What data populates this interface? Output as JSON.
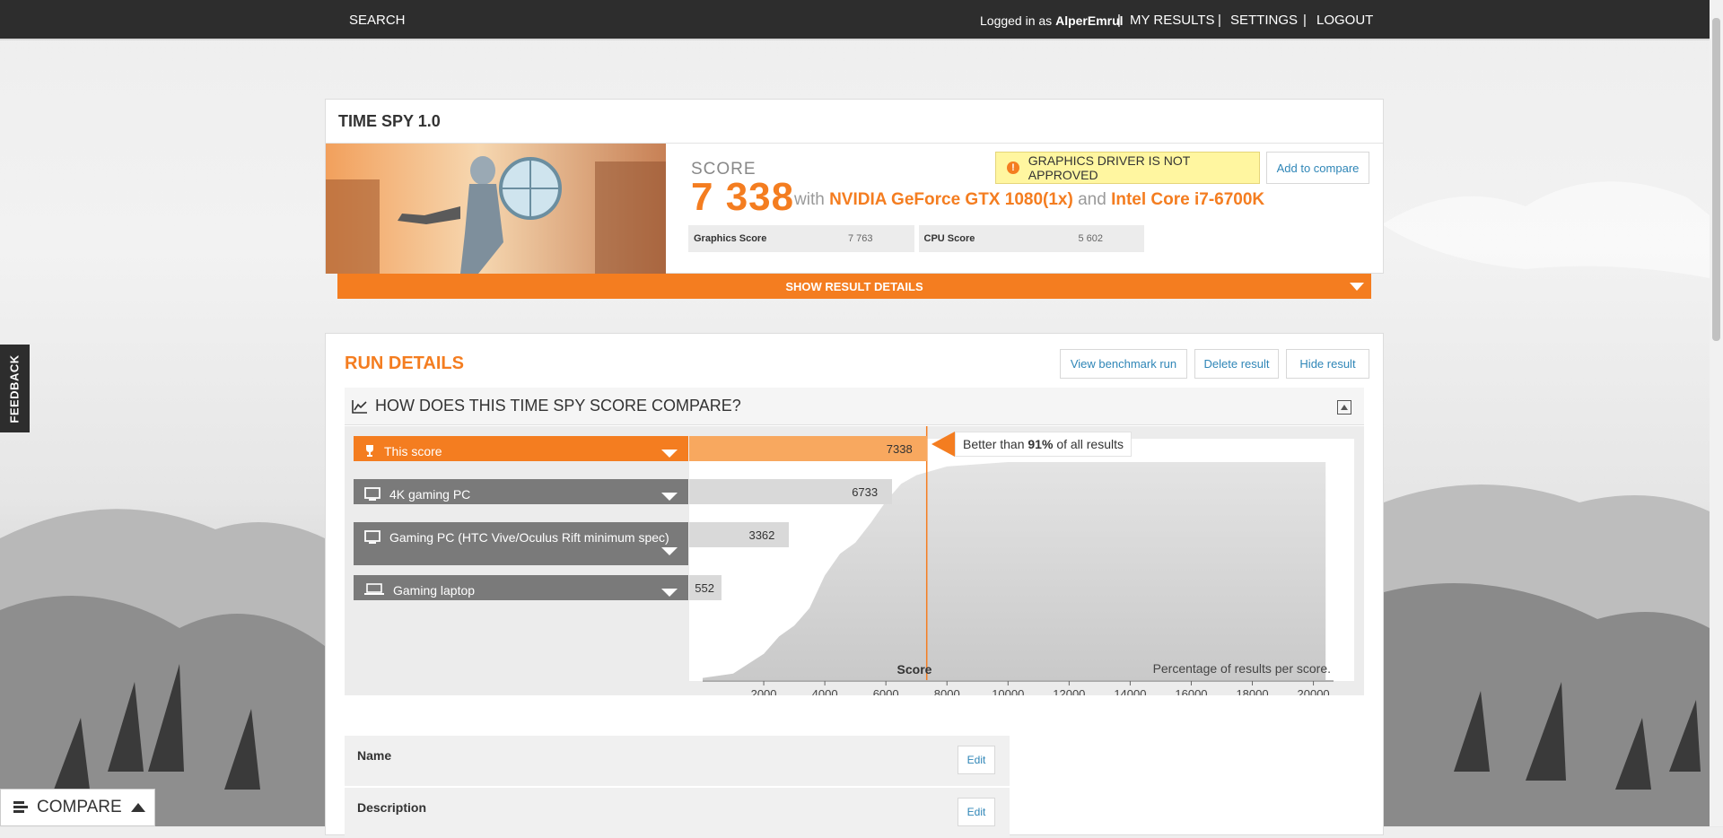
{
  "topbar": {
    "search": "SEARCH",
    "logged_in_prefix": "Logged in as",
    "username": "AlperEmrul",
    "my_results": "MY RESULTS",
    "settings": "SETTINGS",
    "logout": "LOGOUT",
    "separator": "|"
  },
  "feedback": "FEEDBACK",
  "compare_bar": {
    "label": "COMPARE"
  },
  "result": {
    "title": "TIME SPY 1.0",
    "score_label": "SCORE",
    "score": "7 338",
    "with": "with",
    "gpu": "NVIDIA GeForce GTX 1080(1x)",
    "and": "and",
    "cpu": "Intel Core i7-6700K",
    "warning": "GRAPHICS DRIVER IS NOT APPROVED",
    "add_to_compare": "Add to compare",
    "graphics_score_label": "Graphics Score",
    "graphics_score": "7 763",
    "cpu_score_label": "CPU Score",
    "cpu_score": "5 602",
    "show_details": "SHOW RESULT DETAILS"
  },
  "run_details": {
    "title": "RUN DETAILS",
    "view_run": "View benchmark run",
    "delete": "Delete result",
    "hide": "Hide result",
    "compare_title": "HOW DOES THIS TIME SPY SCORE COMPARE?",
    "better_prefix": "Better than",
    "better_pct": "91%",
    "better_suffix": "of all results",
    "axis_title": "Score",
    "pct_label": "Percentage of results per score."
  },
  "chart_data": {
    "type": "area",
    "xlabel": "Score",
    "x_ticks": [
      2000,
      4000,
      6000,
      8000,
      10000,
      12000,
      14000,
      16000,
      18000,
      20000
    ],
    "xlim": [
      0,
      20600
    ],
    "marker": 7338,
    "curve": [
      [
        0,
        0.01
      ],
      [
        1000,
        0.03
      ],
      [
        2000,
        0.12
      ],
      [
        2500,
        0.2
      ],
      [
        3000,
        0.25
      ],
      [
        3500,
        0.33
      ],
      [
        4000,
        0.48
      ],
      [
        4500,
        0.58
      ],
      [
        5000,
        0.63
      ],
      [
        5500,
        0.72
      ],
      [
        6000,
        0.82
      ],
      [
        6500,
        0.9
      ],
      [
        7000,
        0.94
      ],
      [
        8000,
        0.98
      ],
      [
        10000,
        1.0
      ],
      [
        20400,
        1.0
      ]
    ],
    "rows": [
      {
        "name": "This score",
        "value": 7338,
        "label": "7338",
        "icon": "trophy-icon"
      },
      {
        "name": "4K gaming PC",
        "value": 6733,
        "label": "6733",
        "icon": "desktop-icon"
      },
      {
        "name": "Gaming PC (HTC Vive/Oculus Rift minimum spec)",
        "value": 3362,
        "label": "3362",
        "icon": "desktop-icon"
      },
      {
        "name": "Gaming laptop",
        "value": 552,
        "label": "552",
        "icon": "laptop-icon"
      }
    ]
  },
  "fields": {
    "name_label": "Name",
    "description_label": "Description",
    "edit": "Edit"
  },
  "colors": {
    "accent": "#f47d20",
    "link": "#2f86b7",
    "dark": "#2d2d2d"
  }
}
